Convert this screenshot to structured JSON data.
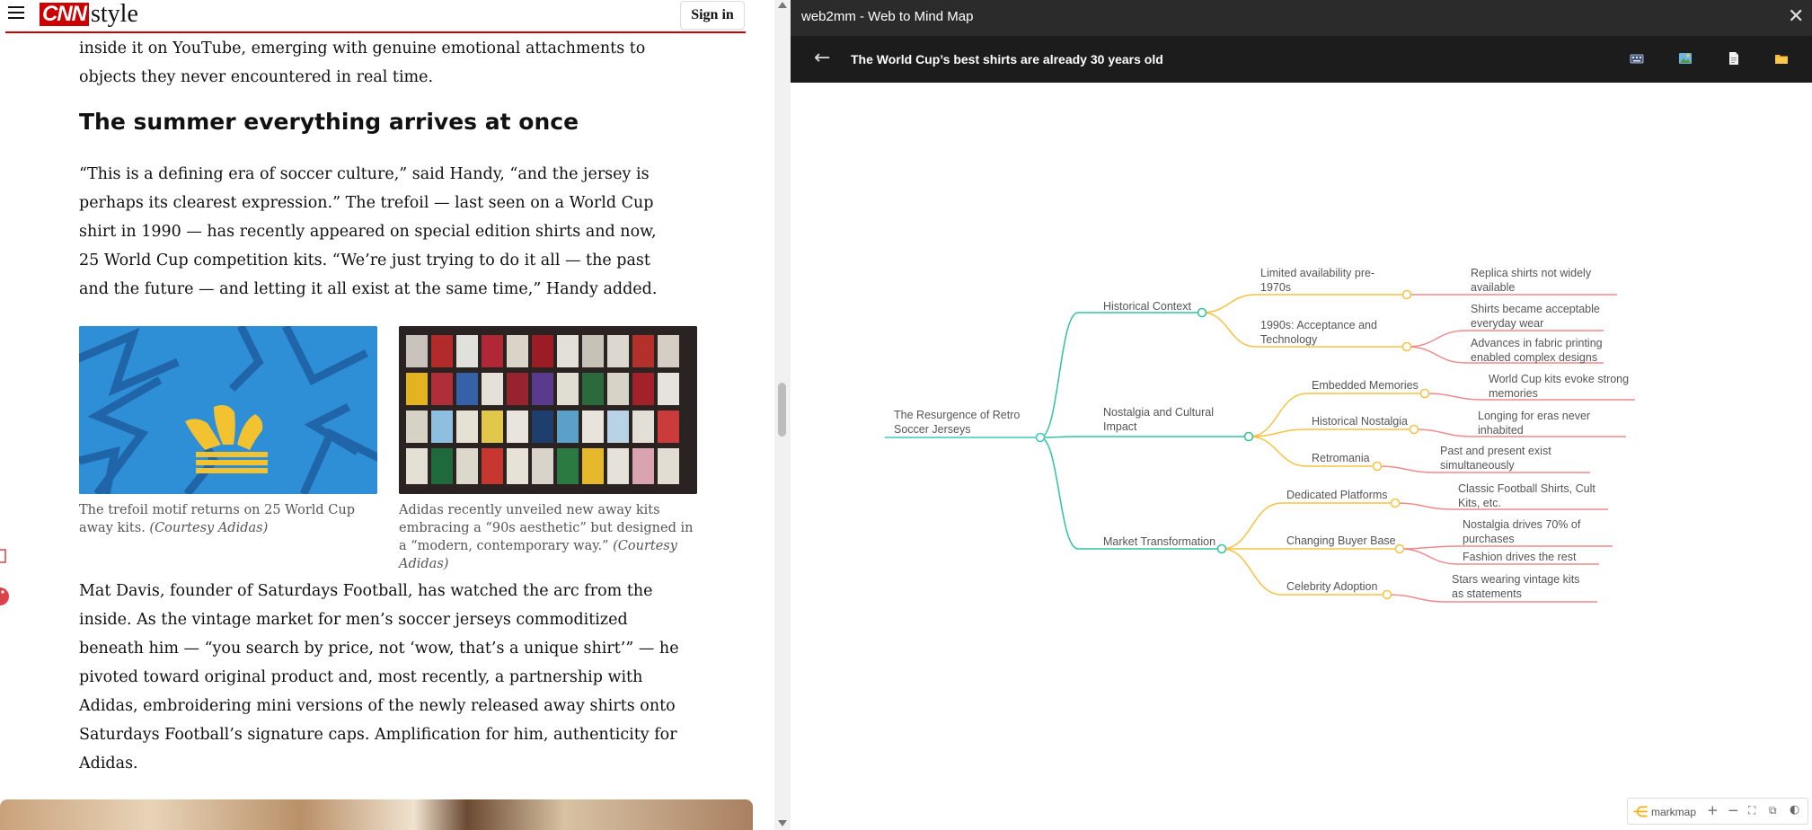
{
  "cnn": {
    "logo_brand": "CNN",
    "logo_section": "style",
    "signin_label": "Sign in"
  },
  "article": {
    "para_top": "inside it on YouTube, emerging with genuine emotional attachments to objects they never encountered in real time.",
    "section_heading": "The summer everything arrives at once",
    "para_quote": "“This is a defining era of soccer culture,” said Handy, “and the jersey is perhaps its clearest expression.” The trefoil — last seen on a World Cup shirt in 1990 — has recently appeared on special edition shirts and now, 25 World Cup competition kits. “We’re just trying to do it all — the past and the future — and letting it all exist at the same time,” Handy added.",
    "caption_1_text": "The trefoil motif returns on 25 World Cup away kits. ",
    "caption_1_credit": "(Courtesy Adidas)",
    "caption_2_text": "Adidas recently unveiled new away kits embracing a “90s aesthetic” but designed in a “modern, contemporary way.” ",
    "caption_2_credit": "(Courtesy Adidas)",
    "para_davis": "Mat Davis, founder of Saturdays Football, has watched the arc from the inside. As the vintage market for men’s soccer jerseys commoditized beneath him — “you search by price, not ‘wow, that’s a unique shirt’” — he pivoted toward original product and, most recently, a partnership with Adidas, embroidering mini versions of the newly released away shirts onto Saturdays Football’s signature caps. Amplification for him, authenticity for Adidas."
  },
  "panel": {
    "title": "web2mm - Web to Mind Map",
    "close_icon": "close-icon",
    "back_icon": "back-arrow-icon",
    "doc_title": "The World Cup’s best shirts are already 30 years old",
    "toolbar_icons": [
      "keyboard-icon",
      "image-icon",
      "document-icon",
      "folder-icon"
    ]
  },
  "mindmap": {
    "colors": {
      "root": "#3cc8c0",
      "branch": "#2ec4a0",
      "sub": "#f6c343",
      "leaf": "#f08a8a"
    },
    "root": [
      "The Resurgence of Retro",
      "Soccer Jerseys"
    ],
    "branches": [
      {
        "label": [
          "Historical Context"
        ],
        "children": [
          {
            "label": [
              "Limited availability pre-",
              "1970s"
            ],
            "leaves": [
              [
                "Replica shirts not widely",
                "available"
              ]
            ]
          },
          {
            "label": [
              "1990s: Acceptance and",
              "Technology"
            ],
            "leaves": [
              [
                "Shirts became acceptable",
                "everyday wear"
              ],
              [
                "Advances in fabric printing",
                "enabled complex designs"
              ]
            ]
          }
        ]
      },
      {
        "label": [
          "Nostalgia and Cultural",
          "Impact"
        ],
        "children": [
          {
            "label": [
              "Embedded Memories"
            ],
            "leaves": [
              [
                "World Cup kits evoke strong",
                "memories"
              ]
            ]
          },
          {
            "label": [
              "Historical Nostalgia"
            ],
            "leaves": [
              [
                "Longing for eras never",
                "inhabited"
              ]
            ]
          },
          {
            "label": [
              "Retromania"
            ],
            "leaves": [
              [
                "Past and present exist",
                "simultaneously"
              ]
            ]
          }
        ]
      },
      {
        "label": [
          "Market Transformation"
        ],
        "children": [
          {
            "label": [
              "Dedicated Platforms"
            ],
            "leaves": [
              [
                "Classic Football Shirts, Cult",
                "Kits, etc."
              ]
            ]
          },
          {
            "label": [
              "Changing Buyer Base"
            ],
            "leaves": [
              [
                "Nostalgia drives 70% of",
                "purchases"
              ],
              [
                "Fashion drives the rest"
              ]
            ]
          },
          {
            "label": [
              "Celebrity Adoption"
            ],
            "leaves": [
              [
                "Stars wearing vintage kits",
                "as statements"
              ]
            ]
          }
        ]
      }
    ]
  },
  "markmap_toolbar": {
    "brand": "markmap",
    "zoom_in": "+",
    "zoom_out": "−",
    "fit": "⛶",
    "window": "⧉",
    "dark": "◐"
  }
}
